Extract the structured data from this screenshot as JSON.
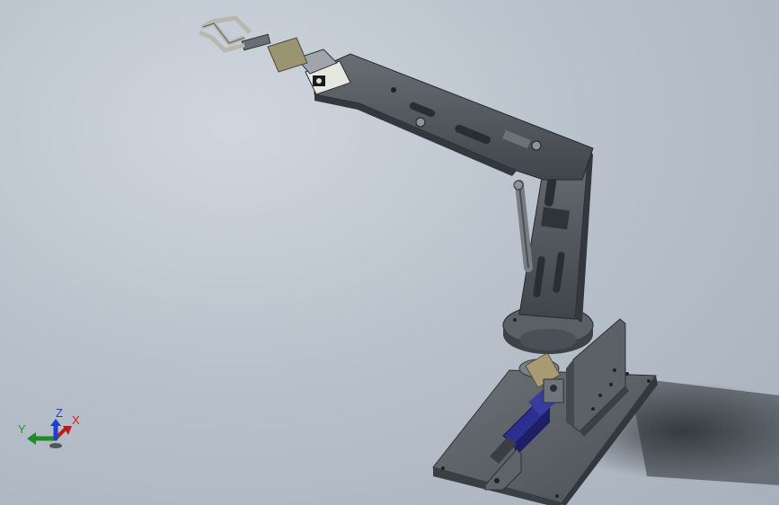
{
  "viewport": {
    "background": "#b9c2cc"
  },
  "triad": {
    "x_label": "X",
    "y_label": "Y",
    "z_label": "Z",
    "x_color": "#d11d1d",
    "y_color": "#1e9a2a",
    "z_color": "#1f3fcf"
  },
  "model": {
    "arm_color": "#4c5257",
    "motor_color": "#2c2f8f",
    "gripper_color": "#b8b8b0",
    "base_color": "#5a6066"
  }
}
